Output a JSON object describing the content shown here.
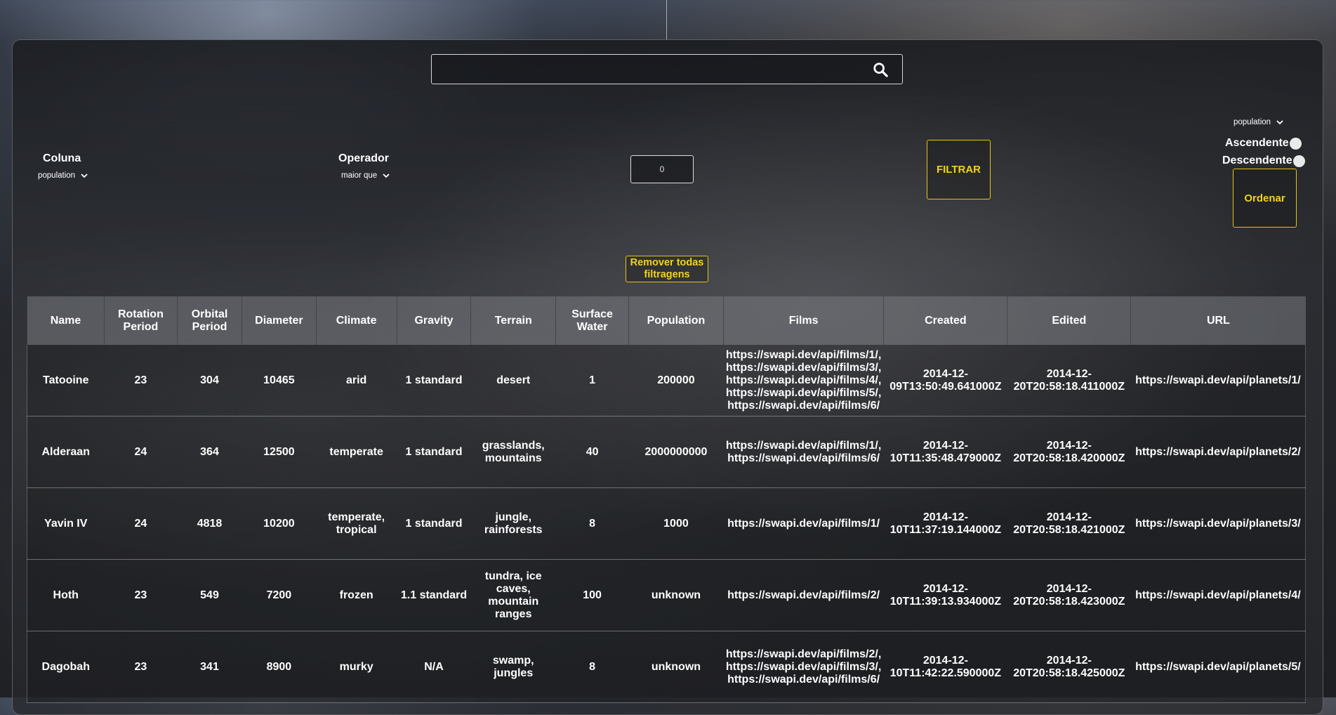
{
  "search": {
    "value": "",
    "icon": "search-icon"
  },
  "filter": {
    "column_label": "Coluna",
    "column_value": "population",
    "operator_label": "Operador",
    "operator_value": "maior que",
    "value": "0",
    "filter_button": "FILTRAR",
    "remove_all": "Remover todas filtragens"
  },
  "sort": {
    "column_value": "population",
    "asc_label": "Ascendente",
    "desc_label": "Descendente",
    "sort_button": "Ordenar"
  },
  "table": {
    "headers": [
      "Name",
      "Rotation Period",
      "Orbital Period",
      "Diameter",
      "Climate",
      "Gravity",
      "Terrain",
      "Surface Water",
      "Population",
      "Films",
      "Created",
      "Edited",
      "URL"
    ],
    "rows": [
      [
        "Tatooine",
        "23",
        "304",
        "10465",
        "arid",
        "1 standard",
        "desert",
        "1",
        "200000",
        "https://swapi.dev/api/films/1/, https://swapi.dev/api/films/3/, https://swapi.dev/api/films/4/, https://swapi.dev/api/films/5/, https://swapi.dev/api/films/6/",
        "2014-12-09T13:50:49.641000Z",
        "2014-12-20T20:58:18.411000Z",
        "https://swapi.dev/api/planets/1/"
      ],
      [
        "Alderaan",
        "24",
        "364",
        "12500",
        "temperate",
        "1 standard",
        "grasslands, mountains",
        "40",
        "2000000000",
        "https://swapi.dev/api/films/1/, https://swapi.dev/api/films/6/",
        "2014-12-10T11:35:48.479000Z",
        "2014-12-20T20:58:18.420000Z",
        "https://swapi.dev/api/planets/2/"
      ],
      [
        "Yavin IV",
        "24",
        "4818",
        "10200",
        "temperate, tropical",
        "1 standard",
        "jungle, rainforests",
        "8",
        "1000",
        "https://swapi.dev/api/films/1/",
        "2014-12-10T11:37:19.144000Z",
        "2014-12-20T20:58:18.421000Z",
        "https://swapi.dev/api/planets/3/"
      ],
      [
        "Hoth",
        "23",
        "549",
        "7200",
        "frozen",
        "1.1 standard",
        "tundra, ice caves, mountain ranges",
        "100",
        "unknown",
        "https://swapi.dev/api/films/2/",
        "2014-12-10T11:39:13.934000Z",
        "2014-12-20T20:58:18.423000Z",
        "https://swapi.dev/api/planets/4/"
      ],
      [
        "Dagobah",
        "23",
        "341",
        "8900",
        "murky",
        "N/A",
        "swamp, jungles",
        "8",
        "unknown",
        "https://swapi.dev/api/films/2/, https://swapi.dev/api/films/3/, https://swapi.dev/api/films/6/",
        "2014-12-10T11:42:22.590000Z",
        "2014-12-20T20:58:18.425000Z",
        "https://swapi.dev/api/planets/5/"
      ]
    ]
  }
}
